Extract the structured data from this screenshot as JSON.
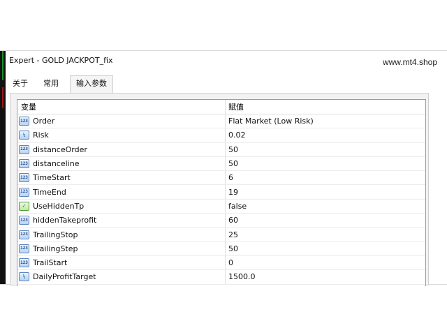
{
  "window": {
    "title": "Expert - GOLD JACKPOT_fix",
    "watermark": "www.mt4.shop"
  },
  "tabs": [
    {
      "label": "关于",
      "active": false
    },
    {
      "label": "常用",
      "active": false
    },
    {
      "label": "输入参数",
      "active": true
    }
  ],
  "table": {
    "headers": {
      "variable": "变量",
      "value": "赋值"
    },
    "rows": [
      {
        "icon": "int-icon",
        "icon_text": "123",
        "name": "Order",
        "value": "Flat Market (Low Risk)"
      },
      {
        "icon": "double-icon",
        "icon_text": "½",
        "name": "Risk",
        "value": "0.02"
      },
      {
        "icon": "int-icon",
        "icon_text": "123",
        "name": "distanceOrder",
        "value": "50"
      },
      {
        "icon": "int-icon",
        "icon_text": "123",
        "name": "distanceline",
        "value": "50"
      },
      {
        "icon": "int-icon",
        "icon_text": "123",
        "name": "TimeStart",
        "value": "6"
      },
      {
        "icon": "int-icon",
        "icon_text": "123",
        "name": "TimeEnd",
        "value": "19"
      },
      {
        "icon": "bool-icon",
        "icon_text": "✓",
        "name": "UseHiddenTp",
        "value": "false"
      },
      {
        "icon": "int-icon",
        "icon_text": "123",
        "name": "hiddenTakeprofit",
        "value": "60"
      },
      {
        "icon": "int-icon",
        "icon_text": "123",
        "name": "TrailingStop",
        "value": "25"
      },
      {
        "icon": "int-icon",
        "icon_text": "123",
        "name": "TrailingStep",
        "value": "50"
      },
      {
        "icon": "int-icon",
        "icon_text": "123",
        "name": "TrailStart",
        "value": "0"
      },
      {
        "icon": "double-icon",
        "icon_text": "½",
        "name": "DailyProfitTarget",
        "value": "1500.0"
      }
    ]
  }
}
